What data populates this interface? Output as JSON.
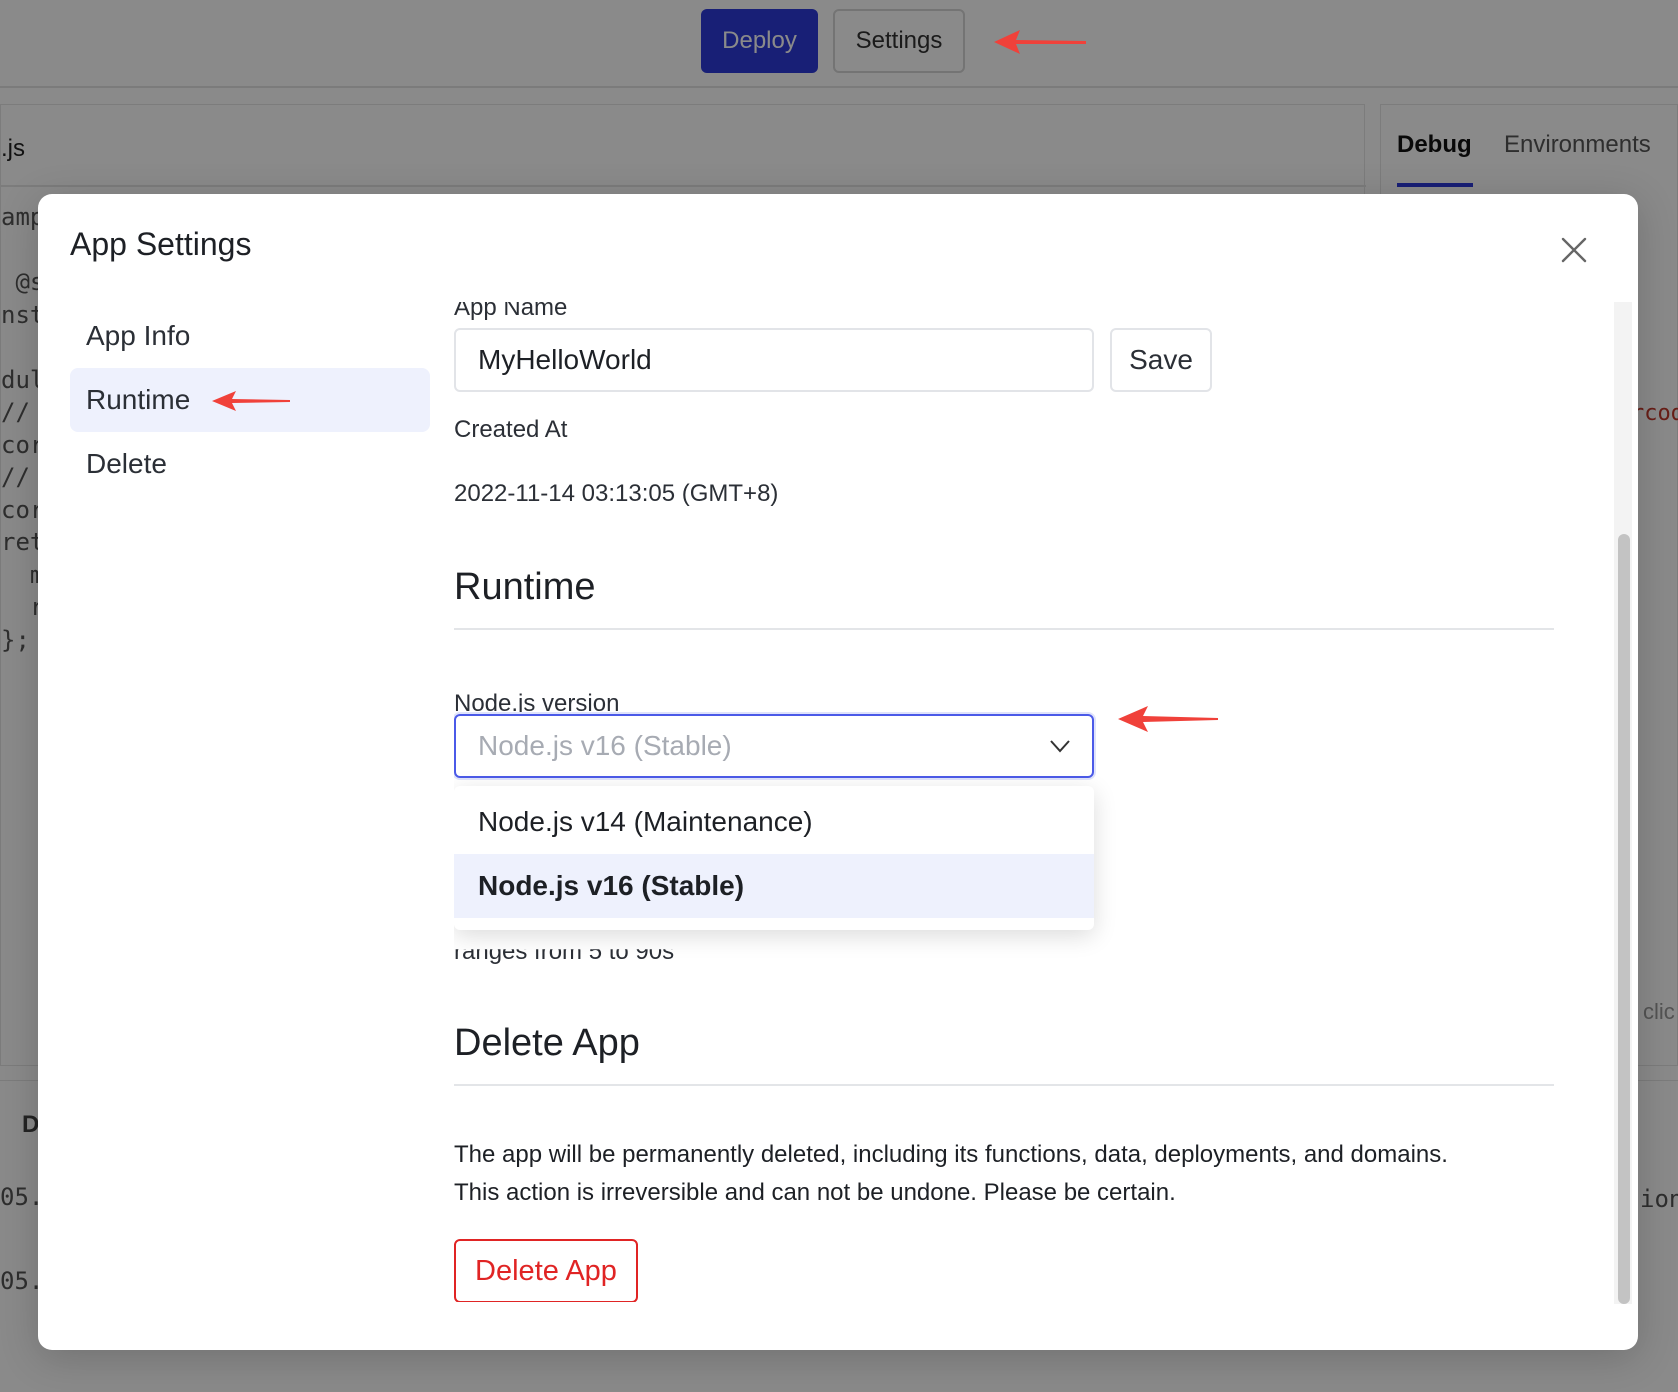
{
  "toolbar": {
    "deploy_label": "Deploy",
    "settings_label": "Settings"
  },
  "editor": {
    "tab_label": ".js",
    "code_lines": [
      "amp",
      "",
      " @s",
      "nst",
      "",
      "dul",
      "//",
      "cor",
      "//",
      "cor",
      "ret",
      "  m",
      "  r",
      "};"
    ]
  },
  "right_panel": {
    "tab_debug": "Debug",
    "tab_environments": "Environments",
    "snippet_1": "rcod",
    "snippet_2": "clic",
    "snippet_3": "ion."
  },
  "bottom_panel": {
    "label": "D",
    "line_1": "05.",
    "line_2": "05."
  },
  "modal": {
    "title": "App Settings",
    "nav": [
      {
        "label": "App Info"
      },
      {
        "label": "Runtime"
      },
      {
        "label": "Delete"
      }
    ],
    "app_name_label": "App Name",
    "app_name_value": "MyHelloWorld",
    "save_label": "Save",
    "created_at_label": "Created At",
    "created_at_value": "2022-11-14 03:13:05 (GMT+8)",
    "runtime_title": "Runtime",
    "node_version_label": "Node.js version",
    "node_version_selected": "Node.js v16 (Stable)",
    "node_options": [
      "Node.js v14 (Maintenance)",
      "Node.js v16 (Stable)"
    ],
    "timeout_hint": "ranges from 5 to 90s",
    "delete_title": "Delete App",
    "delete_warning_1": "The app will be permanently deleted, including its functions, data, deployments, and domains.",
    "delete_warning_2": "This action is irreversible and can not be undone. Please be certain.",
    "delete_button": "Delete App"
  },
  "colors": {
    "accent": "#2e3adb",
    "danger": "#e02424",
    "annotation_arrow": "#f0413a"
  }
}
